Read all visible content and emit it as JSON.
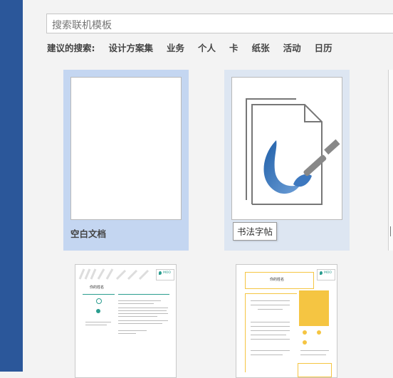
{
  "search": {
    "placeholder": "搜索联机模板"
  },
  "suggestions": {
    "label": "建议的搜索:",
    "items": [
      "设计方案集",
      "业务",
      "个人",
      "卡",
      "纸张",
      "活动",
      "日历"
    ]
  },
  "templates": [
    {
      "label": "空白文档"
    },
    {
      "label": "书法字帖",
      "tooltip": "书法字帖"
    }
  ],
  "resume1": {
    "brand": "MOO",
    "name": "你的姓名"
  },
  "resume2": {
    "brand": "MOO",
    "name": "你的姓名"
  },
  "colors": {
    "accent": "#2b579a",
    "selected_tile": "#c4d6f1",
    "hover_tile": "#dde6f2",
    "resume_teal": "#2a9d8f",
    "resume_yellow": "#f5c542"
  }
}
